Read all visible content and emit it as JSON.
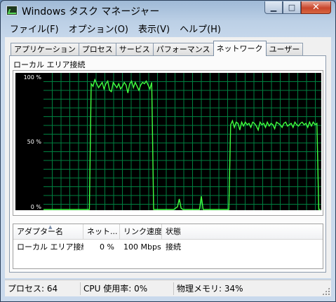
{
  "window": {
    "title": "Windows タスク マネージャー",
    "min_glyph": "▁",
    "max_glyph": "□",
    "close_glyph": "✕",
    "icon": "task-manager-icon"
  },
  "menu": {
    "items": [
      "ファイル(F)",
      "オプション(O)",
      "表示(V)",
      "ヘルプ(H)"
    ]
  },
  "tabs": {
    "items": [
      "アプリケーション",
      "プロセス",
      "サービス",
      "パフォーマンス",
      "ネットワーク",
      "ユーザー"
    ],
    "active": "ネットワーク"
  },
  "network": {
    "group_label": "ローカル エリア接続",
    "graph": {
      "axis_labels": [
        "100 %",
        "50 %",
        "0 %"
      ],
      "grid_color": "#008040",
      "line_color": "#40ff40",
      "background": "#000000",
      "utilization": [
        0,
        0,
        0,
        0,
        0,
        0,
        0,
        0,
        0,
        0,
        0,
        0,
        0,
        0,
        0,
        0,
        0,
        0,
        0,
        0,
        0,
        0,
        0,
        0,
        0,
        0,
        95,
        93,
        98,
        95,
        92,
        94,
        96,
        91,
        95,
        97,
        90,
        89,
        96,
        94,
        92,
        95,
        91,
        93,
        96,
        94,
        88,
        95,
        97,
        92,
        96,
        93,
        90,
        94,
        96,
        95,
        97,
        94,
        91,
        96,
        0,
        0,
        0,
        0,
        0,
        0,
        0,
        0,
        0,
        0,
        0,
        0,
        1,
        2,
        8,
        1,
        0,
        0,
        0,
        0,
        0,
        0,
        0,
        0,
        0,
        0,
        10,
        0,
        0,
        0,
        0,
        0,
        0,
        0,
        0,
        0,
        0,
        0,
        0,
        0,
        0,
        0,
        64,
        67,
        62,
        66,
        65,
        60,
        66,
        63,
        66,
        64,
        65,
        62,
        66,
        65,
        63,
        60,
        66,
        64,
        65,
        62,
        66,
        63,
        65,
        64,
        61,
        66,
        65,
        64,
        62,
        65,
        66,
        63,
        64,
        65,
        62,
        66,
        64,
        63,
        65,
        66,
        64,
        65,
        62,
        66,
        63,
        66,
        64,
        65,
        0,
        0
      ]
    }
  },
  "adapters": {
    "columns": [
      "アダプター名",
      "ネット...",
      "リンク速度",
      "状態"
    ],
    "rows": [
      {
        "name": "ローカル エリア接続",
        "utilization": "0 %",
        "link_speed": "100 Mbps",
        "state": "接続"
      }
    ]
  },
  "status": {
    "processes": "プロセス: 64",
    "cpu": "CPU 使用率: 0%",
    "memory": "物理メモリ: 34%"
  }
}
